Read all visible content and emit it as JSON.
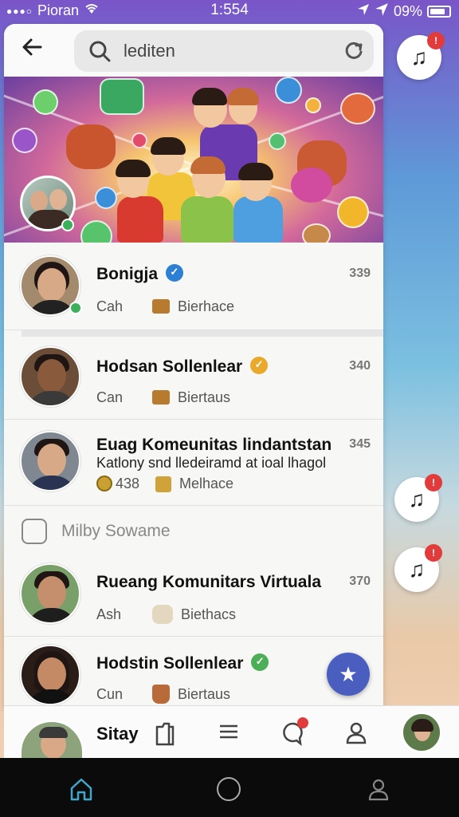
{
  "status_bar": {
    "carrier": "Pioran",
    "time": "1:554",
    "battery": "09%"
  },
  "header": {
    "search_text": "lediten"
  },
  "chats": [
    {
      "name": "Bonigja",
      "sub": "Cah",
      "tag": "Bierhace",
      "count": "339",
      "badge_color": "#2d7fd3"
    },
    {
      "name": "Hodsan Sollenlear",
      "sub": "Can",
      "tag": "Biertaus",
      "count": "340",
      "badge_color": "#e9a92a"
    },
    {
      "name": "Euag Komeunitas lindantstan",
      "line2": "Katlony snd lledeiramd at ioal lhagol",
      "sub": "438",
      "tag": "Melhace",
      "count": "345"
    }
  ],
  "section": {
    "title": "Milby Sowame"
  },
  "chats2": [
    {
      "name": "Rueang Komunitars Virtuala",
      "sub": "Ash",
      "tag": "Biethacs",
      "count": "370"
    },
    {
      "name": "Hodstin Sollenlear",
      "sub": "Cun",
      "tag": "Biertaus",
      "badge_color": "#4cae57"
    }
  ],
  "bottom_bar": {
    "me_label": "Sitay"
  },
  "colors": {
    "accent": "#4a5ec0",
    "badge_red": "#e23b3b",
    "online": "#3bb05a"
  },
  "icons": {
    "back": "arrow-left",
    "search": "magnifier",
    "music": "music-note",
    "fab": "star"
  }
}
